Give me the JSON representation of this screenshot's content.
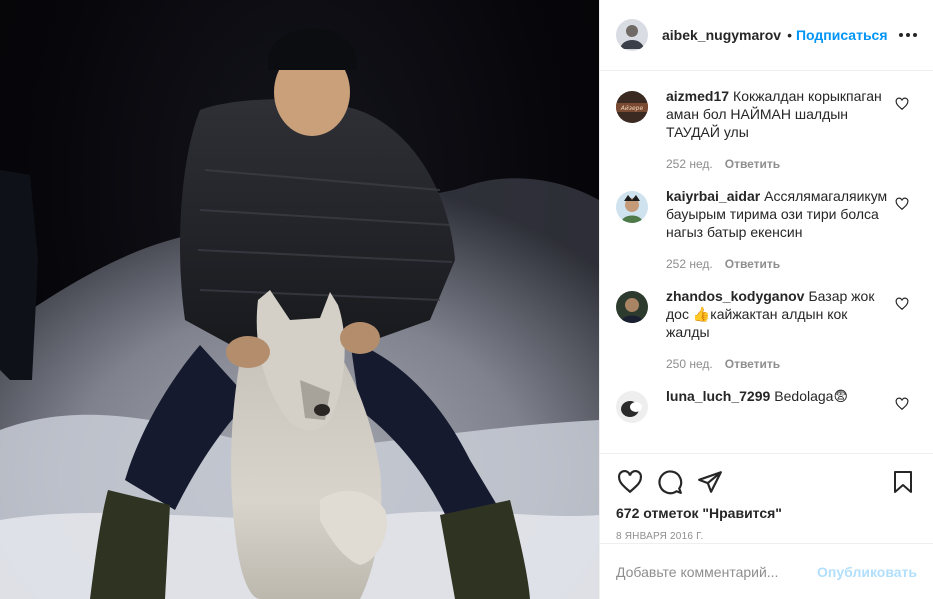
{
  "post": {
    "username": "aibek_nugymarov",
    "separator": "•",
    "follow_label": "Подписаться",
    "avatar_icon": "user-avatar-icon",
    "more_icon": "more-options-icon"
  },
  "comments": [
    {
      "username": "aizmed17",
      "text": "Кокжалдан корыкпаган аман бол НАЙМАН шалдын ТАУДАЙ улы",
      "time": "252 нед.",
      "reply_label": "Ответить",
      "avatar_text": "Айзере"
    },
    {
      "username": "kaiyrbai_aidar",
      "text": "Ассялямагаляикум бауырым тирима ози тири болса нагыз батыр екенсин",
      "time": "252 нед.",
      "reply_label": "Ответить"
    },
    {
      "username": "zhandos_kodyganov",
      "text": "Базар жок дос 👍кайжактан алдын кок жалды",
      "time": "250 нед.",
      "reply_label": "Ответить"
    },
    {
      "username": "luna_luch_7299",
      "text": "Bedolaga😨"
    }
  ],
  "actions": {
    "like_icon": "heart-icon",
    "comment_icon": "comment-icon",
    "share_icon": "share-icon",
    "save_icon": "bookmark-icon",
    "likes_text": "672 отметок \"Нравится\"",
    "date_text": "8 января 2016 г."
  },
  "add_comment": {
    "placeholder": "Добавьте комментарий...",
    "post_label": "Опубликовать"
  },
  "colors": {
    "accent": "#0095f6",
    "post_disabled": "#b2dffc",
    "muted": "#8e8e8e",
    "text": "#262626"
  }
}
